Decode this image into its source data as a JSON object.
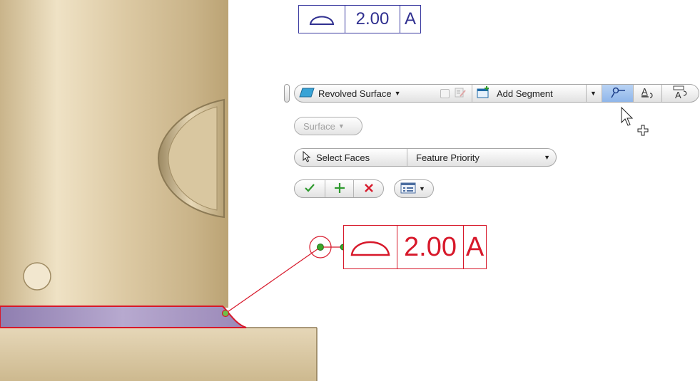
{
  "fcf_top": {
    "symbol": "profile-of-surface-icon",
    "tolerance": "2.00",
    "datum": "A",
    "color": "#303090"
  },
  "toolbar": {
    "geometry_label": "Revolved Surface",
    "add_segment_label": "Add Segment",
    "surface_label": "Surface",
    "select_faces_label": "Select Faces",
    "priority_value": "Feature Priority",
    "icons": [
      "revolved-surface-icon",
      "checkbox-icon",
      "edit-text-icon",
      "add-segment-icon",
      "leader-icon",
      "text-style-icon",
      "annotation-text-icon",
      "ok-check-icon",
      "plus-icon",
      "cancel-x-icon",
      "options-menu-icon",
      "select-arrow-icon"
    ]
  },
  "fcf_main": {
    "symbol": "profile-of-surface-icon",
    "tolerance": "2.00",
    "datum": "A",
    "color": "#d7182a"
  },
  "colors": {
    "part": "#d8c7a0",
    "highlight": "#d7182a",
    "selected_face": "#9a88b8",
    "accent": "#8fb6ea"
  }
}
